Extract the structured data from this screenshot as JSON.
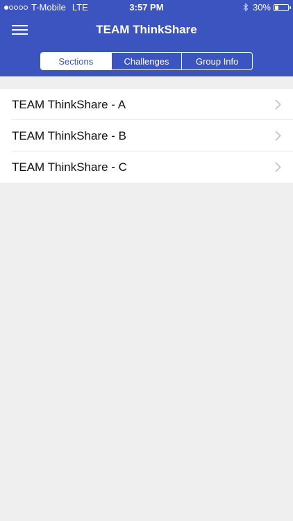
{
  "status_bar": {
    "carrier": "T-Mobile",
    "network": "LTE",
    "time": "3:57 PM",
    "battery": "30%",
    "battery_level": 0.3,
    "signal_bars_filled": 1,
    "signal_bars_total": 5
  },
  "nav": {
    "title": "TEAM ThinkShare",
    "menu_icon": "hamburger-menu-icon"
  },
  "tabs": [
    {
      "label": "Sections",
      "active": true
    },
    {
      "label": "Challenges",
      "active": false
    },
    {
      "label": "Group Info",
      "active": false
    }
  ],
  "sections": [
    {
      "label": "TEAM ThinkShare - A"
    },
    {
      "label": "TEAM ThinkShare - B"
    },
    {
      "label": "TEAM ThinkShare - C"
    }
  ],
  "colors": {
    "header_bg": "#3c54bf",
    "page_bg": "#efefef"
  }
}
